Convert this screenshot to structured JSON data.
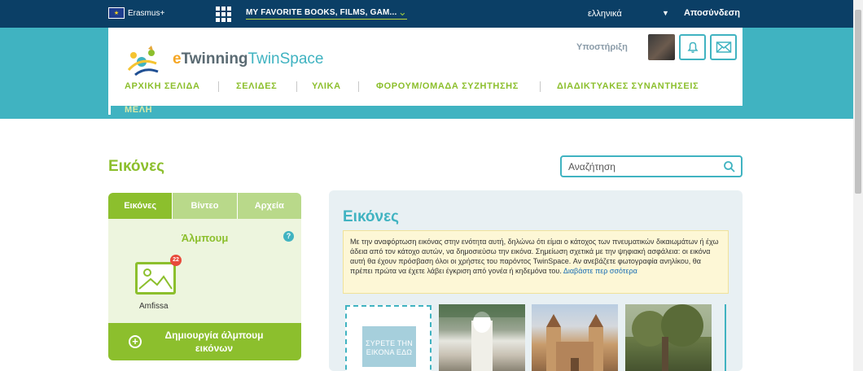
{
  "topbar": {
    "erasmus_label": "Erasmus+",
    "twinspace_name": "MY FAVORITE BOOKS, FILMS, GAM...",
    "language": "ελληνικά",
    "logout_label": "Αποσύνδεση"
  },
  "header": {
    "logo_text_e": "e",
    "logo_text_twinning": "Twinning",
    "logo_text_twinspace": "TwinSpace",
    "support_label": "Υποστήριξη",
    "nav": [
      {
        "label": "ΑΡΧΙΚΗ ΣΕΛΙΔΑ"
      },
      {
        "label": "ΣΕΛΙΔΕΣ"
      },
      {
        "label": "ΥΛΙΚΑ"
      },
      {
        "label": "ΦΟΡΟΥΜ/ΟΜΑΔΑ ΣΥΖΗΤΗΣΗΣ"
      },
      {
        "label": "ΔΙΑΔΙΚΤΥΑΚΕΣ ΣΥΝΑΝΤΗΣΕΙΣ"
      },
      {
        "label": "ΜΕΛΗ"
      }
    ]
  },
  "page": {
    "title": "Εικόνες",
    "search_placeholder": "Αναζήτηση"
  },
  "sidebar": {
    "tabs": [
      {
        "label": "Εικόνες",
        "active": true
      },
      {
        "label": "Βίντεο",
        "active": false
      },
      {
        "label": "Αρχεία",
        "active": false
      }
    ],
    "albums_title": "Άλμπουμ",
    "help_label": "?",
    "album": {
      "name": "Amfissa",
      "count": "22"
    },
    "create_album_label": "Δημιουργία άλμπουμ εικόνων"
  },
  "main": {
    "title": "Εικόνες",
    "notice_text": "Με την αναφόρτωση εικόνας στην ενότητα αυτή, δηλώνω ότι είμαι ο κάτοχος των πνευματικών δικαιωμάτων ή έχω άδεια από τον κάτοχο αυτών, να δημοσιεύσω την εικόνα. Σημείωση σχετικά με την ψηφιακή ασφάλεια: οι εικόνα αυτή θα έχουν πρόσβαση όλοι οι χρήστες του παρόντος TwinSpace. Αν ανεβάζετε φωτογραφία ανηλίκου, θα πρέπει πρώτα να έχετε λάβει έγκριση από γονέα ή κηδεμόνα του.",
    "notice_link": "Διαβάστε περ σσότερα",
    "upload_label": "ΣΥΡΕΤΕ ΤΗΝ ΕΙΚΟΝΑ ΕΔΩ"
  },
  "colors": {
    "topbar": "#0b3f66",
    "teal": "#40b3c1",
    "green": "#8cbf2d",
    "notice_bg": "#fdf7d6"
  },
  "icons": {
    "topbar_grid": "grid-icon",
    "notifications": "bell-icon",
    "messages": "mail-icon",
    "search": "search-icon",
    "help": "help-icon",
    "add": "plus-circle-icon"
  }
}
